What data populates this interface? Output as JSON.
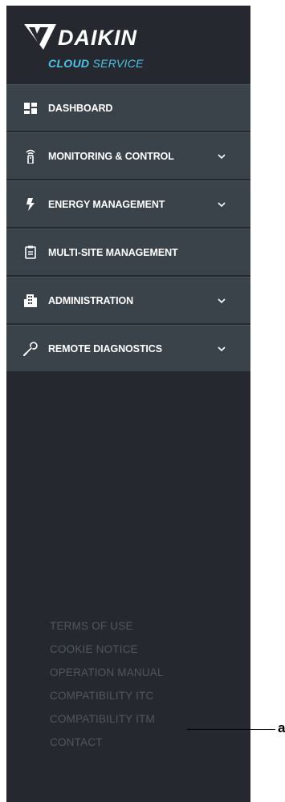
{
  "brand": {
    "name": "DAIKIN",
    "sub_bold": "CLOUD",
    "sub_rest": " SERVICE",
    "accent_color": "#4ec4e9"
  },
  "menu": {
    "items": [
      {
        "label": "DASHBOARD",
        "icon": "dashboard-grid-icon",
        "has_submenu": false
      },
      {
        "label": "MONITORING & CONTROL",
        "icon": "remote-control-icon",
        "has_submenu": true
      },
      {
        "label": "ENERGY MANAGEMENT",
        "icon": "lightning-bolt-icon",
        "has_submenu": true
      },
      {
        "label": "MULTI-SITE MANAGEMENT",
        "icon": "clipboard-icon",
        "has_submenu": false
      },
      {
        "label": "ADMINISTRATION",
        "icon": "building-icon",
        "has_submenu": true
      },
      {
        "label": "REMOTE DIAGNOSTICS",
        "icon": "wrench-icon",
        "has_submenu": true
      }
    ]
  },
  "footer": {
    "links": [
      "TERMS OF USE",
      "COOKIE NOTICE",
      "OPERATION MANUAL",
      "COMPATIBILITY ITC",
      "COMPATIBILITY ITM",
      "CONTACT"
    ]
  },
  "annotation": {
    "callout_label": "a"
  },
  "colors": {
    "sidebar_bg": "#25292f",
    "menu_item_bg": "#3b434a",
    "footer_text": "#50575e"
  }
}
